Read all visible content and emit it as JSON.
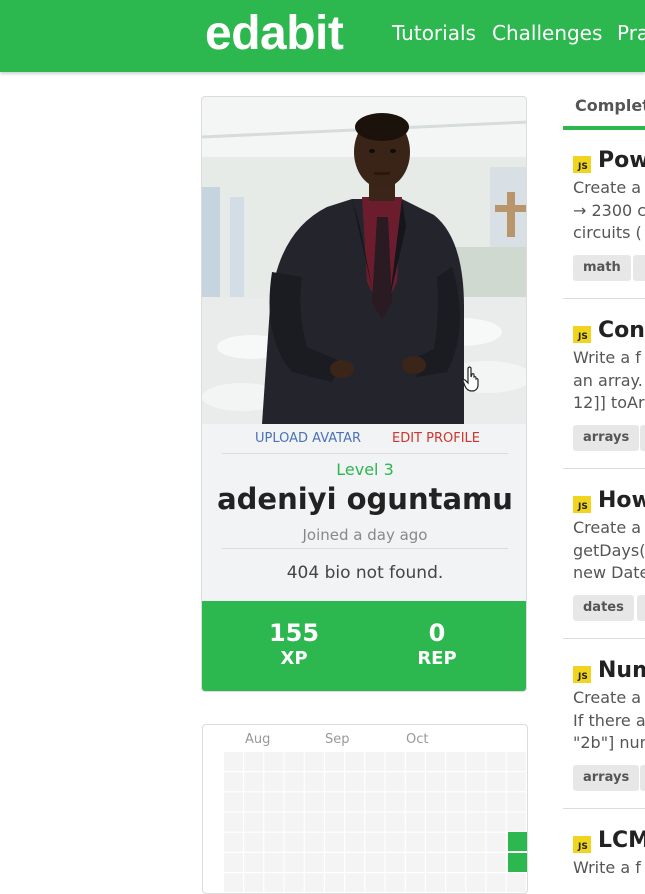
{
  "header": {
    "logo": "edabit",
    "nav": [
      "Tutorials",
      "Challenges",
      "Pra"
    ]
  },
  "profile": {
    "upload_avatar": "UPLOAD AVATAR",
    "edit_profile": "EDIT PROFILE",
    "level": "Level 3",
    "name": "adeniyi oguntamu",
    "joined": "Joined a day ago",
    "bio": "404 bio not found.",
    "stats": [
      {
        "value": "155",
        "label": "XP"
      },
      {
        "value": "0",
        "label": "REP"
      }
    ]
  },
  "activity": {
    "months": [
      "Aug",
      "Sep",
      "Oct"
    ]
  },
  "challenges_tab": {
    "label": "Complet"
  },
  "challenges": [
    {
      "lang": "JS",
      "title": "Powe",
      "lines": [
        "Create a",
        "→ 2300 c",
        "circuits ("
      ],
      "tag": "math"
    },
    {
      "lang": "JS",
      "title": "Conv",
      "lines": [
        "Write a f",
        "an array.",
        "12]] toAr"
      ],
      "tag": "arrays"
    },
    {
      "lang": "JS",
      "title": "How",
      "lines": [
        "Create a",
        "getDays(",
        "new Date"
      ],
      "tag": "dates"
    },
    {
      "lang": "JS",
      "title": "Num",
      "lines": [
        "Create a",
        "If there a",
        "\"2b\"] num"
      ],
      "tag": "arrays"
    },
    {
      "lang": "JS",
      "title": "LCM",
      "lines": [
        "Write a f"
      ],
      "tag": ""
    }
  ],
  "colors": {
    "brand_green": "#2cb74f",
    "link_blue": "#4a72b8",
    "link_red": "#d0342c",
    "js_yellow": "#f0d41d"
  },
  "icons": [
    "js-badge-icon",
    "hand-cursor-icon"
  ]
}
